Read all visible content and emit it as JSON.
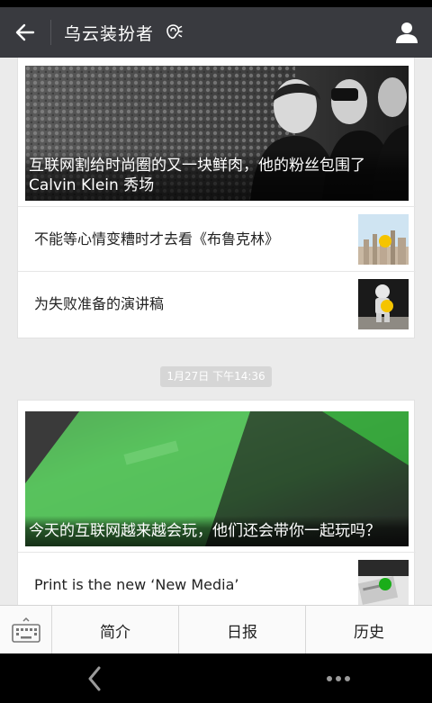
{
  "header": {
    "title": "乌云装扮者"
  },
  "cards": [
    {
      "hero_title": "互联网割给时尚圈的又一块鲜肉，他的粉丝包围了Calvin Klein 秀场",
      "items": [
        {
          "label": "不能等心情变糟时才去看《布鲁克林》"
        },
        {
          "label": "为失败准备的演讲稿"
        }
      ]
    },
    {
      "hero_title": "今天的互联网越来越会玩，他们还会带你一起玩吗？",
      "items": [
        {
          "label": "Print is the new ‘New Media’"
        }
      ]
    }
  ],
  "timestamp": "1月27日 下午14:36",
  "menu": [
    "简介",
    "日报",
    "历史"
  ],
  "colors": {
    "title_bar": "#393a3f",
    "accent_dot": "#f5c400",
    "green_dot": "#1aad19"
  }
}
